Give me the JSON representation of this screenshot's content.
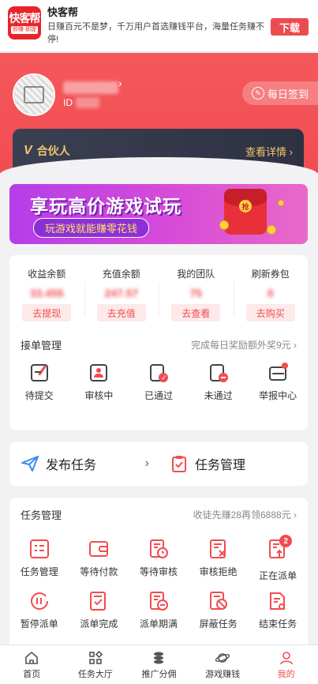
{
  "top_banner": {
    "app_name": "快客帮",
    "logo_text": "快客帮",
    "logo_sub": "即赚·即提",
    "description": "日赚百元不是梦，千万用户首选赚钱平台，海量任务赚不停!",
    "download_label": "下载"
  },
  "profile": {
    "id_label": "ID",
    "signin_label": "每日签到",
    "partner_label": "合伙人",
    "partner_icon": "V",
    "partner_link": "查看详情 ›"
  },
  "promo": {
    "title": "享玩高价游戏试玩",
    "subtitle": "玩游戏就能赚零花钱",
    "redpack_char": "抢"
  },
  "balances": [
    {
      "label": "收益余额",
      "value": "33.455",
      "button": "去提现"
    },
    {
      "label": "充值余额",
      "value": "247.57",
      "button": "去充值"
    },
    {
      "label": "我的团队",
      "value": "75",
      "button": "去查看"
    },
    {
      "label": "刷新券包",
      "value": "0",
      "button": "去购买"
    }
  ],
  "orders": {
    "title": "接单管理",
    "link": "完成每日奖励额外奖9元 ›",
    "items": [
      {
        "label": "待提交",
        "icon": "edit-icon"
      },
      {
        "label": "审核中",
        "icon": "user-card-icon"
      },
      {
        "label": "已通过",
        "icon": "check-doc-icon"
      },
      {
        "label": "未通过",
        "icon": "reject-doc-icon"
      },
      {
        "label": "举报中心",
        "icon": "mail-alert-icon"
      }
    ]
  },
  "actions": {
    "publish": "发布任务",
    "manage": "任务管理"
  },
  "tasks": {
    "title": "任务管理",
    "link": "收徒先赚28再领6888元 ›",
    "items": [
      {
        "label": "任务管理",
        "icon": "list-icon"
      },
      {
        "label": "等待付款",
        "icon": "wallet-icon"
      },
      {
        "label": "等待审核",
        "icon": "clock-doc-icon"
      },
      {
        "label": "审核拒绝",
        "icon": "x-doc-icon"
      },
      {
        "label": "正在派单",
        "icon": "upload-doc-icon",
        "badge": "2"
      },
      {
        "label": "暂停派单",
        "icon": "pause-icon"
      },
      {
        "label": "派单完成",
        "icon": "done-doc-icon"
      },
      {
        "label": "派单期满",
        "icon": "minus-doc-icon"
      },
      {
        "label": "屏蔽任务",
        "icon": "block-doc-icon"
      },
      {
        "label": "结束任务",
        "icon": "end-doc-icon"
      }
    ]
  },
  "nav": [
    {
      "label": "首页",
      "icon": "home-icon"
    },
    {
      "label": "任务大厅",
      "icon": "grid-icon"
    },
    {
      "label": "推广分佣",
      "icon": "coins-icon"
    },
    {
      "label": "游戏赚钱",
      "icon": "planet-icon"
    },
    {
      "label": "我的",
      "icon": "user-icon",
      "active": true
    }
  ],
  "colors": {
    "primary": "#f24c50",
    "gold": "#f3c76b",
    "dark_card": "#2e3142"
  }
}
